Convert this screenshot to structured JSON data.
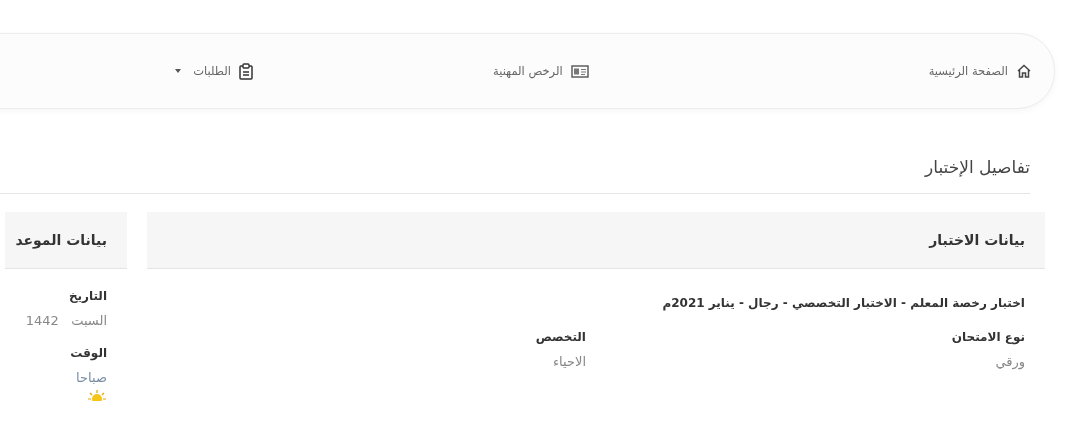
{
  "nav": {
    "items": [
      {
        "label": "الصفحة الرئيسية",
        "kind": "home",
        "dropdown": false
      },
      {
        "label": "الرخص المهنية",
        "kind": "card",
        "dropdown": false
      },
      {
        "label": "الطلبات",
        "kind": "clipboard",
        "dropdown": true
      }
    ]
  },
  "page_title": "تفاصيل الإختبار",
  "cards": [
    {
      "kind": "columns",
      "title": "بيانات الاختبار",
      "headline": "اختبار رخصة المعلم - الاختبار التخصصي - رجال - يناير 2021م",
      "fields": [
        {
          "label": "نوع الامتحان",
          "value": "ورقي",
          "kind": "plain"
        },
        {
          "label": "التخصص",
          "value": "الاحياء",
          "kind": "plain"
        }
      ]
    },
    {
      "kind": "stack",
      "title": "بيانات الموعد",
      "fields": [
        {
          "label": "التاريخ",
          "value": "السبت   1442",
          "kind": "plain"
        },
        {
          "label": "الوقت",
          "value": "صباحا",
          "kind": "link"
        }
      ]
    }
  ]
}
